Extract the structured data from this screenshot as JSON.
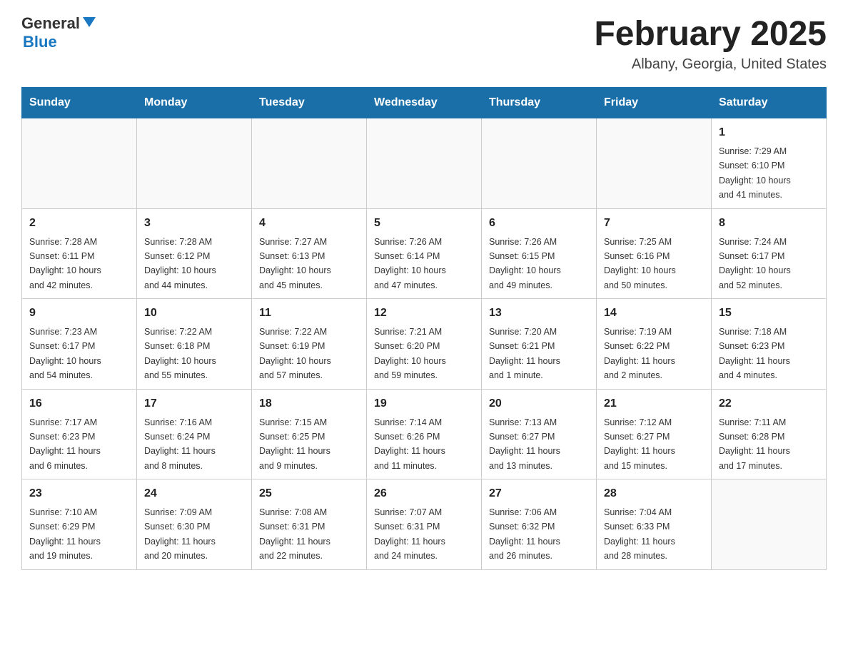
{
  "header": {
    "logo_general": "General",
    "logo_blue": "Blue",
    "month_title": "February 2025",
    "location": "Albany, Georgia, United States"
  },
  "days_of_week": [
    "Sunday",
    "Monday",
    "Tuesday",
    "Wednesday",
    "Thursday",
    "Friday",
    "Saturday"
  ],
  "weeks": [
    [
      {
        "day": "",
        "info": ""
      },
      {
        "day": "",
        "info": ""
      },
      {
        "day": "",
        "info": ""
      },
      {
        "day": "",
        "info": ""
      },
      {
        "day": "",
        "info": ""
      },
      {
        "day": "",
        "info": ""
      },
      {
        "day": "1",
        "info": "Sunrise: 7:29 AM\nSunset: 6:10 PM\nDaylight: 10 hours\nand 41 minutes."
      }
    ],
    [
      {
        "day": "2",
        "info": "Sunrise: 7:28 AM\nSunset: 6:11 PM\nDaylight: 10 hours\nand 42 minutes."
      },
      {
        "day": "3",
        "info": "Sunrise: 7:28 AM\nSunset: 6:12 PM\nDaylight: 10 hours\nand 44 minutes."
      },
      {
        "day": "4",
        "info": "Sunrise: 7:27 AM\nSunset: 6:13 PM\nDaylight: 10 hours\nand 45 minutes."
      },
      {
        "day": "5",
        "info": "Sunrise: 7:26 AM\nSunset: 6:14 PM\nDaylight: 10 hours\nand 47 minutes."
      },
      {
        "day": "6",
        "info": "Sunrise: 7:26 AM\nSunset: 6:15 PM\nDaylight: 10 hours\nand 49 minutes."
      },
      {
        "day": "7",
        "info": "Sunrise: 7:25 AM\nSunset: 6:16 PM\nDaylight: 10 hours\nand 50 minutes."
      },
      {
        "day": "8",
        "info": "Sunrise: 7:24 AM\nSunset: 6:17 PM\nDaylight: 10 hours\nand 52 minutes."
      }
    ],
    [
      {
        "day": "9",
        "info": "Sunrise: 7:23 AM\nSunset: 6:17 PM\nDaylight: 10 hours\nand 54 minutes."
      },
      {
        "day": "10",
        "info": "Sunrise: 7:22 AM\nSunset: 6:18 PM\nDaylight: 10 hours\nand 55 minutes."
      },
      {
        "day": "11",
        "info": "Sunrise: 7:22 AM\nSunset: 6:19 PM\nDaylight: 10 hours\nand 57 minutes."
      },
      {
        "day": "12",
        "info": "Sunrise: 7:21 AM\nSunset: 6:20 PM\nDaylight: 10 hours\nand 59 minutes."
      },
      {
        "day": "13",
        "info": "Sunrise: 7:20 AM\nSunset: 6:21 PM\nDaylight: 11 hours\nand 1 minute."
      },
      {
        "day": "14",
        "info": "Sunrise: 7:19 AM\nSunset: 6:22 PM\nDaylight: 11 hours\nand 2 minutes."
      },
      {
        "day": "15",
        "info": "Sunrise: 7:18 AM\nSunset: 6:23 PM\nDaylight: 11 hours\nand 4 minutes."
      }
    ],
    [
      {
        "day": "16",
        "info": "Sunrise: 7:17 AM\nSunset: 6:23 PM\nDaylight: 11 hours\nand 6 minutes."
      },
      {
        "day": "17",
        "info": "Sunrise: 7:16 AM\nSunset: 6:24 PM\nDaylight: 11 hours\nand 8 minutes."
      },
      {
        "day": "18",
        "info": "Sunrise: 7:15 AM\nSunset: 6:25 PM\nDaylight: 11 hours\nand 9 minutes."
      },
      {
        "day": "19",
        "info": "Sunrise: 7:14 AM\nSunset: 6:26 PM\nDaylight: 11 hours\nand 11 minutes."
      },
      {
        "day": "20",
        "info": "Sunrise: 7:13 AM\nSunset: 6:27 PM\nDaylight: 11 hours\nand 13 minutes."
      },
      {
        "day": "21",
        "info": "Sunrise: 7:12 AM\nSunset: 6:27 PM\nDaylight: 11 hours\nand 15 minutes."
      },
      {
        "day": "22",
        "info": "Sunrise: 7:11 AM\nSunset: 6:28 PM\nDaylight: 11 hours\nand 17 minutes."
      }
    ],
    [
      {
        "day": "23",
        "info": "Sunrise: 7:10 AM\nSunset: 6:29 PM\nDaylight: 11 hours\nand 19 minutes."
      },
      {
        "day": "24",
        "info": "Sunrise: 7:09 AM\nSunset: 6:30 PM\nDaylight: 11 hours\nand 20 minutes."
      },
      {
        "day": "25",
        "info": "Sunrise: 7:08 AM\nSunset: 6:31 PM\nDaylight: 11 hours\nand 22 minutes."
      },
      {
        "day": "26",
        "info": "Sunrise: 7:07 AM\nSunset: 6:31 PM\nDaylight: 11 hours\nand 24 minutes."
      },
      {
        "day": "27",
        "info": "Sunrise: 7:06 AM\nSunset: 6:32 PM\nDaylight: 11 hours\nand 26 minutes."
      },
      {
        "day": "28",
        "info": "Sunrise: 7:04 AM\nSunset: 6:33 PM\nDaylight: 11 hours\nand 28 minutes."
      },
      {
        "day": "",
        "info": ""
      }
    ]
  ]
}
